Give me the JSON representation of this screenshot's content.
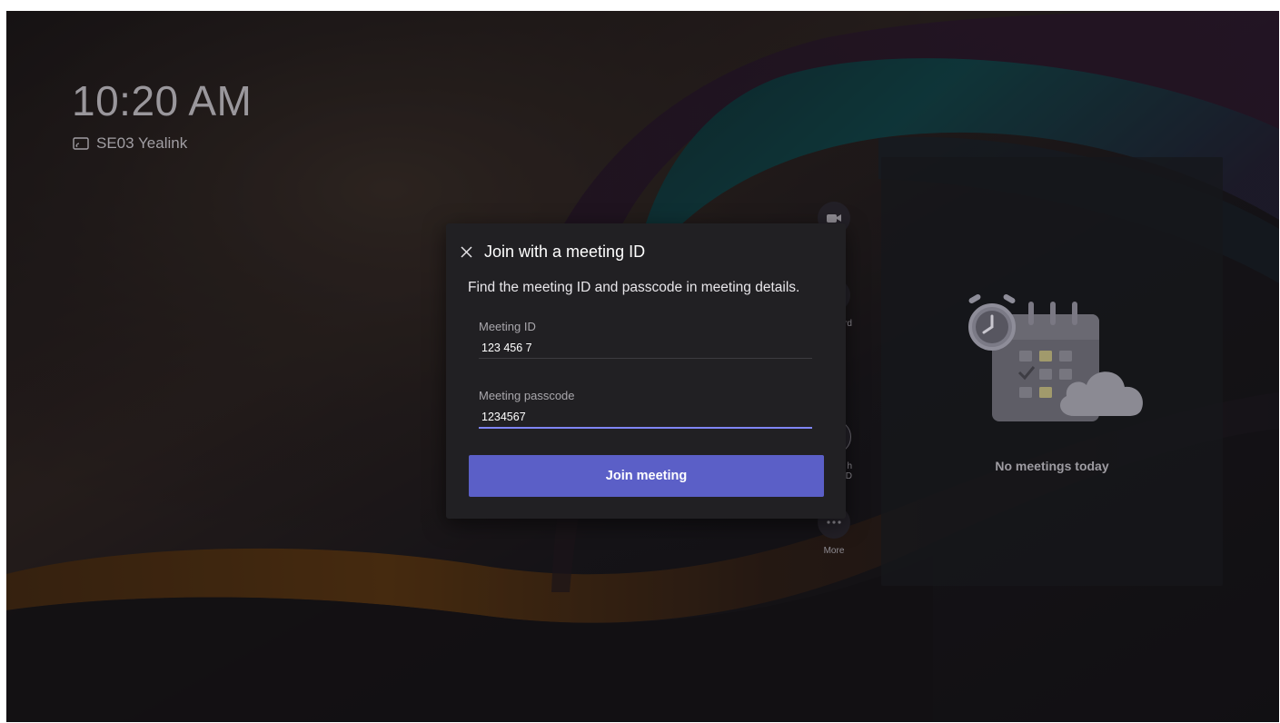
{
  "status": {
    "time": "10:20 AM",
    "device_name": "SE03 Yealink"
  },
  "rail": {
    "items": [
      {
        "label": "",
        "icon": "video-camera-icon"
      },
      {
        "label": "rd",
        "icon": "whiteboard-icon"
      },
      {
        "label": "h\nID",
        "icon": "join-with-id-icon"
      },
      {
        "label": "More",
        "icon": "more-dots-icon"
      }
    ]
  },
  "meetings_panel": {
    "empty_text": "No meetings today",
    "illustration": "calendar-clock-cloud-icon"
  },
  "dialog": {
    "close_icon": "close-icon",
    "title": "Join with a meeting ID",
    "subtitle": "Find the meeting ID and passcode in meeting details.",
    "meeting_id": {
      "label": "Meeting ID",
      "value": "123 456 7"
    },
    "passcode": {
      "label": "Meeting passcode",
      "value": "1234567"
    },
    "join_button": "Join meeting"
  },
  "colors": {
    "accent": "#5b5fc7",
    "focus_underline": "#7f85f5",
    "dialog_bg": "#212023"
  }
}
